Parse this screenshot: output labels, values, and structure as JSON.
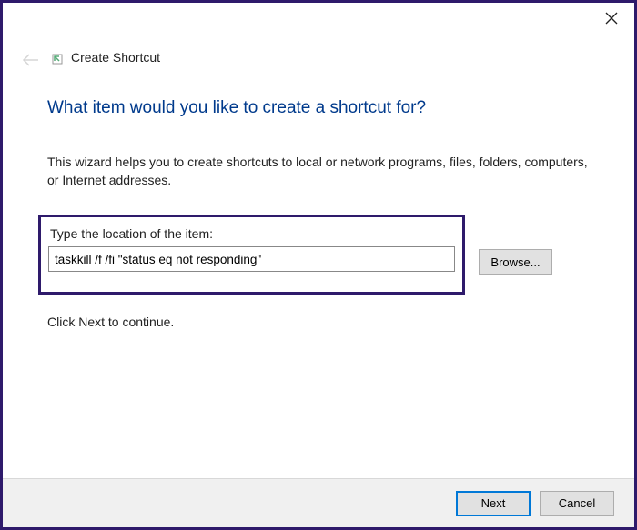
{
  "window": {
    "title": "Create Shortcut"
  },
  "heading": "What item would you like to create a shortcut for?",
  "description": "This wizard helps you to create shortcuts to local or network programs, files, folders, computers, or Internet addresses.",
  "location": {
    "label": "Type the location of the item:",
    "value": "taskkill /f /fi \"status eq not responding\""
  },
  "buttons": {
    "browse": "Browse...",
    "next": "Next",
    "cancel": "Cancel"
  },
  "continue_text": "Click Next to continue."
}
